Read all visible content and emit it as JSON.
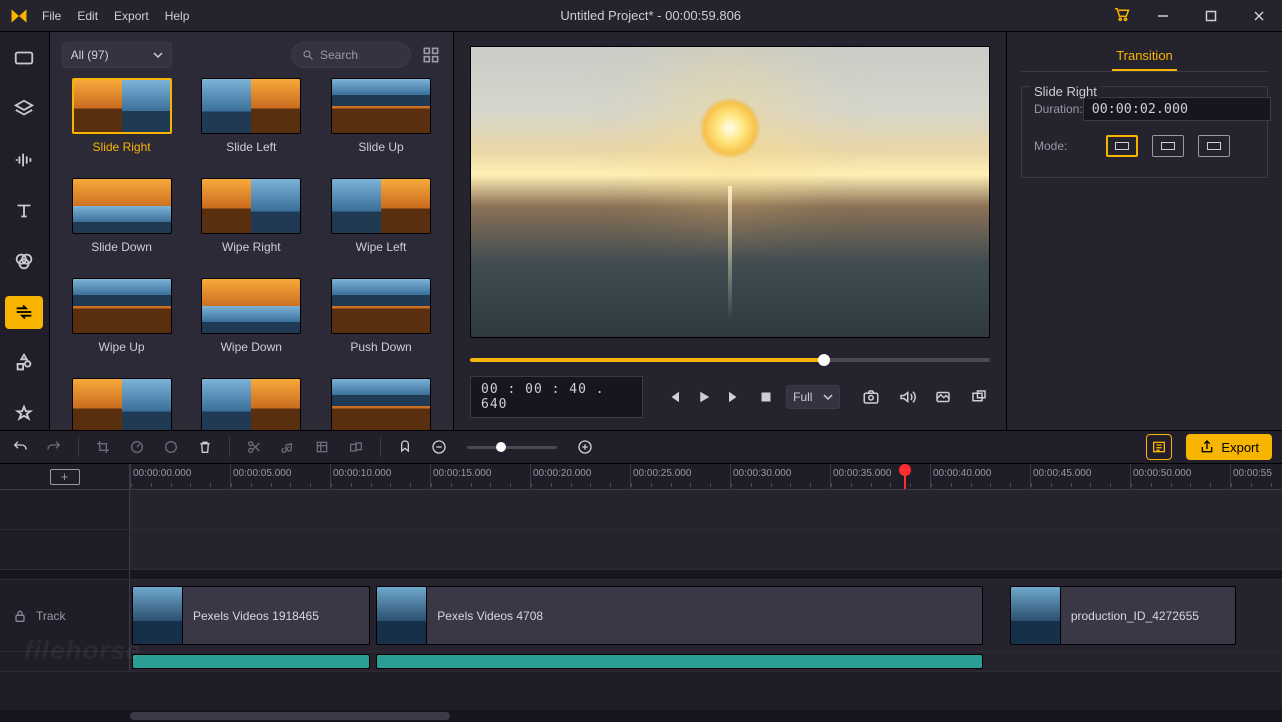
{
  "titlebar": {
    "menu": [
      "File",
      "Edit",
      "Export",
      "Help"
    ],
    "title": "Untitled Project* - 00:00:59.806"
  },
  "sidebar": {
    "items": [
      {
        "name": "media",
        "active": false
      },
      {
        "name": "layers",
        "active": false
      },
      {
        "name": "audio",
        "active": false
      },
      {
        "name": "text",
        "active": false
      },
      {
        "name": "filters",
        "active": false
      },
      {
        "name": "transitions",
        "active": true
      },
      {
        "name": "elements",
        "active": false
      },
      {
        "name": "favorites",
        "active": false
      }
    ]
  },
  "library": {
    "filter_label": "All (97)",
    "search_placeholder": "Search",
    "transitions": [
      {
        "label": "Slide Right",
        "selected": true,
        "split": "v"
      },
      {
        "label": "Slide Left",
        "selected": false,
        "split": "v2"
      },
      {
        "label": "Slide Up",
        "selected": false,
        "split": "h"
      },
      {
        "label": "Slide Down",
        "selected": false,
        "split": "h2"
      },
      {
        "label": "Wipe Right",
        "selected": false,
        "split": "v"
      },
      {
        "label": "Wipe Left",
        "selected": false,
        "split": "v2"
      },
      {
        "label": "Wipe Up",
        "selected": false,
        "split": "h"
      },
      {
        "label": "Wipe Down",
        "selected": false,
        "split": "h2"
      },
      {
        "label": "Push Down",
        "selected": false,
        "split": "h"
      },
      {
        "label": "",
        "selected": false,
        "split": "v"
      },
      {
        "label": "",
        "selected": false,
        "split": "v2"
      },
      {
        "label": "",
        "selected": false,
        "split": "h"
      }
    ]
  },
  "preview": {
    "current_time": "00 : 00 : 40 . 640",
    "playback_position_pct": 68,
    "ratio_label": "Full"
  },
  "properties": {
    "tab": "Transition",
    "group_title": "Slide Right",
    "duration_label": "Duration:",
    "duration_value": "00:00:02.000",
    "mode_label": "Mode:",
    "mode_active_index": 0
  },
  "timeline_toolbar": {
    "export_label": "Export"
  },
  "timeline": {
    "ruler": [
      "00:00:00.000",
      "00:00:05.000",
      "00:00:10.000",
      "00:00:15.000",
      "00:00:20.000",
      "00:00:25.000",
      "00:00:30.000",
      "00:00:35.000",
      "00:00:40.000",
      "00:00:45.000",
      "00:00:50.000",
      "00:00:55"
    ],
    "playhead_pct": 67.2,
    "track_label": "Track",
    "clips": [
      {
        "label": "Pexels Videos 1918465",
        "start_pct": 0,
        "width_pct": 21
      },
      {
        "label": "Pexels Videos 4708",
        "start_pct": 21.2,
        "width_pct": 53
      },
      {
        "label": "production_ID_4272655",
        "start_pct": 76.2,
        "width_pct": 20
      }
    ],
    "transition_marker_pct": 23
  },
  "watermark": "filehorse"
}
